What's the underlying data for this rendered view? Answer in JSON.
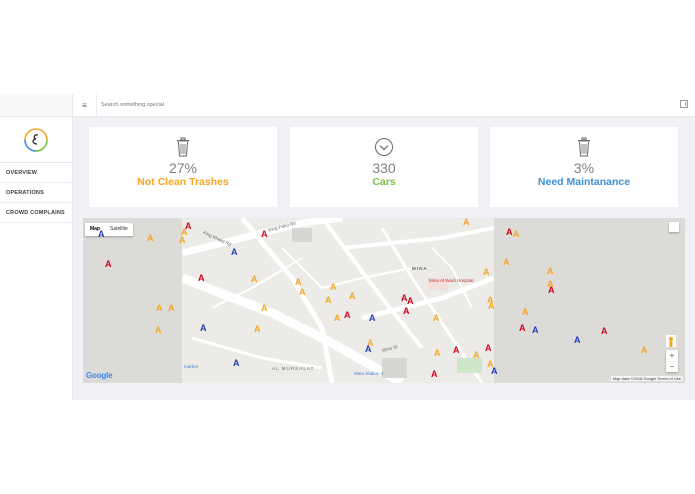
{
  "sidebar": {
    "items": [
      {
        "label": "OVERVIEW"
      },
      {
        "label": "OPERATIONS"
      },
      {
        "label": "CROWD COMPLAINS"
      }
    ]
  },
  "header": {
    "search_placeholder": "Search something special"
  },
  "cards": [
    {
      "icon": "trash-icon",
      "value": "27%",
      "label": "Not Clean Trashes",
      "color": "#f5a623"
    },
    {
      "icon": "chevron-down-circle-icon",
      "value": "330",
      "label": "Cars",
      "color": "#7bc043"
    },
    {
      "icon": "trash-icon",
      "value": "3%",
      "label": "Need Maintanance",
      "color": "#3d8fd4"
    }
  ],
  "map": {
    "type_buttons": [
      "Map",
      "Satellite"
    ],
    "labels": {
      "mina": "MINA",
      "hospital": "Mina Al Wadi Hospital",
      "mursalat": "AL MURSALAT",
      "station": "Mina Station 2",
      "king_fahd": "King Fahd Rd",
      "king_khalid": "King Khalid Rd",
      "mina_street": "Mina St",
      "market": "market"
    },
    "zoom_in": "+",
    "zoom_out": "−",
    "google": "Google",
    "attribution": "Map data ©2018 Google   Terms of Use",
    "marker_colors": {
      "orange": "#f5a623",
      "red": "#d0021b",
      "blue": "#1f3cb5"
    }
  }
}
